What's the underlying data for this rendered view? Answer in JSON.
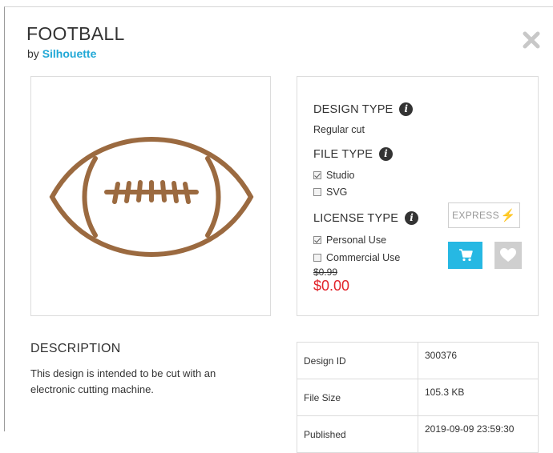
{
  "product": {
    "title": "FOOTBALL",
    "by_prefix": "by",
    "author": "Silhouette"
  },
  "icons": {
    "close": "close-icon",
    "info": "info-icon",
    "cart": "shopping-cart-icon",
    "heart": "heart-icon",
    "bolt": "lightning-bolt-icon"
  },
  "options": {
    "design_type": {
      "heading": "DESIGN TYPE",
      "value": "Regular cut"
    },
    "file_type": {
      "heading": "FILE TYPE",
      "choices": [
        {
          "label": "Studio",
          "checked": true
        },
        {
          "label": "SVG",
          "checked": false
        }
      ]
    },
    "license_type": {
      "heading": "LICENSE TYPE",
      "choices": [
        {
          "label": "Personal Use",
          "checked": true
        },
        {
          "label": "Commercial Use",
          "checked": false
        }
      ]
    },
    "old_price": "$0.99",
    "price": "$0.00",
    "express_label": "EXPRESS"
  },
  "description": {
    "heading": "DESCRIPTION",
    "text": "This design is intended to be cut with an electronic cutting machine."
  },
  "details": [
    {
      "key": "Design ID",
      "value": "300376"
    },
    {
      "key": "File Size",
      "value": "105.3 KB"
    },
    {
      "key": "Published",
      "value": "2019-09-09 23:59:30"
    }
  ],
  "colors": {
    "accent": "#26b8e3",
    "author_link": "#21a8d6",
    "price": "#e2232a",
    "football": "#9b6a40"
  }
}
